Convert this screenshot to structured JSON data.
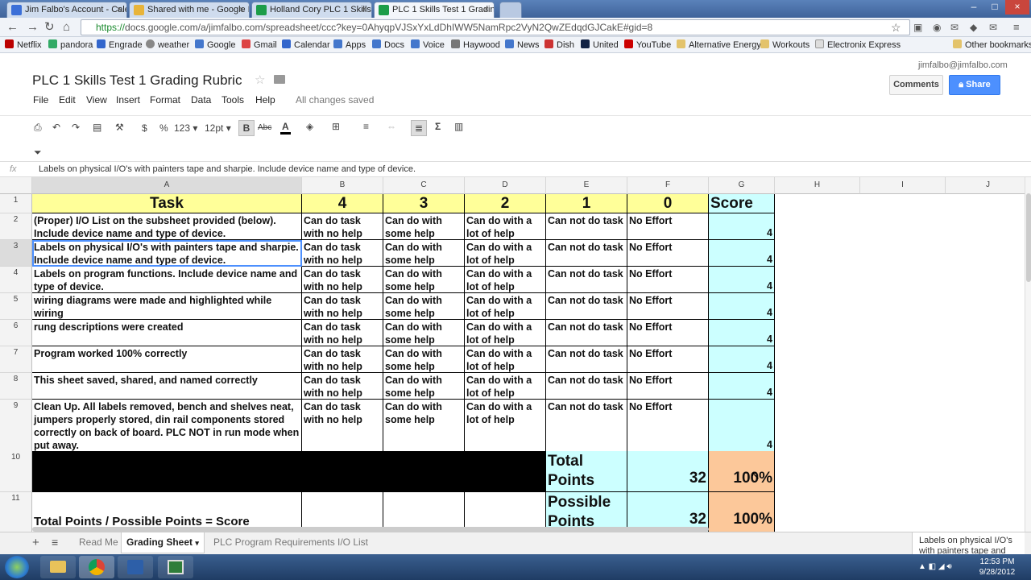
{
  "browser": {
    "tabs": [
      {
        "label": "Jim Falbo's Account - Cale"
      },
      {
        "label": "Shared with me - Google D"
      },
      {
        "label": "Holland Cory PLC 1 Skills T"
      },
      {
        "label": "PLC 1 Skills Test 1 Grading"
      }
    ],
    "url_scheme": "https://",
    "url_rest": "docs.google.com/a/jimfalbo.com/spreadsheet/ccc?key=0AhyqpVJSxYxLdDhIWW5NamRpc2VyN2QwZEdqdGJCakE#gid=8",
    "bookmarks": [
      "Netflix",
      "pandora",
      "Engrade",
      "weather",
      "Google",
      "Gmail",
      "Calendar",
      "Apps",
      "Docs",
      "Voice",
      "Haywood",
      "News",
      "Dish",
      "United",
      "YouTube",
      "Alternative Energy",
      "Workouts",
      "Electronix Express"
    ],
    "other_bookmarks": "Other bookmarks"
  },
  "doc": {
    "title": "PLC 1 Skills Test 1 Grading Rubric",
    "menu": [
      "File",
      "Edit",
      "View",
      "Insert",
      "Format",
      "Data",
      "Tools",
      "Help"
    ],
    "saved_status": "All changes saved",
    "user": "jimfalbo@jimfalbo.com",
    "comments_label": "Comments",
    "share_label": "Share"
  },
  "toolbar": {
    "currency": "$",
    "percent": "%",
    "number_format": "123",
    "font_size": "12pt",
    "bold": "B",
    "strike": "Abc",
    "text_color": "A",
    "sum": "Σ"
  },
  "formula_bar": {
    "fx": "fx",
    "content": "Labels on physical I/O's with painters tape and sharpie. Include device name and type of device."
  },
  "columns": [
    "A",
    "B",
    "C",
    "D",
    "E",
    "F",
    "G",
    "H",
    "I",
    "J"
  ],
  "header_row": {
    "task": "Task",
    "c4": "4",
    "c3": "3",
    "c2": "2",
    "c1": "1",
    "c0": "0",
    "score": "Score"
  },
  "rows": [
    {
      "num": "2",
      "task": "(Proper) I/O List on the subsheet provided (below). Include device name and type of device.",
      "b": "Can do task with no help",
      "c": "Can do with some help",
      "d": "Can do with a lot of help",
      "e": "Can not do task",
      "f": "No Effort",
      "g": "4"
    },
    {
      "num": "3",
      "task": "Labels on physical I/O's with painters tape and sharpie. Include device name and type of device.",
      "b": "Can do task with no help",
      "c": "Can do with some help",
      "d": "Can do with a lot of help",
      "e": "Can not do task",
      "f": "No Effort",
      "g": "4"
    },
    {
      "num": "4",
      "task": "Labels on program functions. Include device name and type of device.",
      "b": "Can do task with no help",
      "c": "Can do with some help",
      "d": "Can do with a lot of help",
      "e": "Can not do task",
      "f": "No Effort",
      "g": "4"
    },
    {
      "num": "5",
      "task": "wiring diagrams were made and highlighted while wiring",
      "b": "Can do task with no help",
      "c": "Can do with some help",
      "d": "Can do with a lot of help",
      "e": "Can not do task",
      "f": "No Effort",
      "g": "4"
    },
    {
      "num": "6",
      "task": "rung descriptions were created",
      "b": "Can do task with no help",
      "c": "Can do with some help",
      "d": "Can do with a lot of help",
      "e": "Can not do task",
      "f": "No Effort",
      "g": "4"
    },
    {
      "num": "7",
      "task": "Program worked 100% correctly",
      "b": "Can do task with no help",
      "c": "Can do with some help",
      "d": "Can do with a lot of help",
      "e": "Can not do task",
      "f": "No Effort",
      "g": "4"
    },
    {
      "num": "8",
      "task": "This sheet saved, shared, and named correctly",
      "b": "Can do task with no help",
      "c": "Can do with some help",
      "d": "Can do with a lot of help",
      "e": "Can not do task",
      "f": "No Effort",
      "g": "4"
    },
    {
      "num": "9",
      "task": "Clean Up. All labels removed, bench and shelves neat, jumpers properly stored, din rail components stored correctly on back of board. PLC NOT in run mode when put away.",
      "b": "Can do task with no help",
      "c": "Can do with some help",
      "d": "Can do with a lot of help",
      "e": "Can not do task",
      "f": "No Effort",
      "g": "4"
    }
  ],
  "totals": {
    "row10_num": "10",
    "total_label": "Total Points",
    "total_value": "32",
    "total_pct": "100%",
    "row11_num": "11",
    "possible_label": "Possible Points",
    "possible_value": "32",
    "possible_pct": "100%",
    "formula_text": "Total Points / Possible Points = Score"
  },
  "sheet_tabs": {
    "tabs": [
      "Read Me",
      "Grading Sheet",
      "PLC Program Requirements",
      "I/O List"
    ],
    "active": "Grading Sheet",
    "preview": "Labels on physical I/O's with painters tape and"
  },
  "clock": {
    "time": "12:53 PM",
    "date": "9/28/2012"
  }
}
